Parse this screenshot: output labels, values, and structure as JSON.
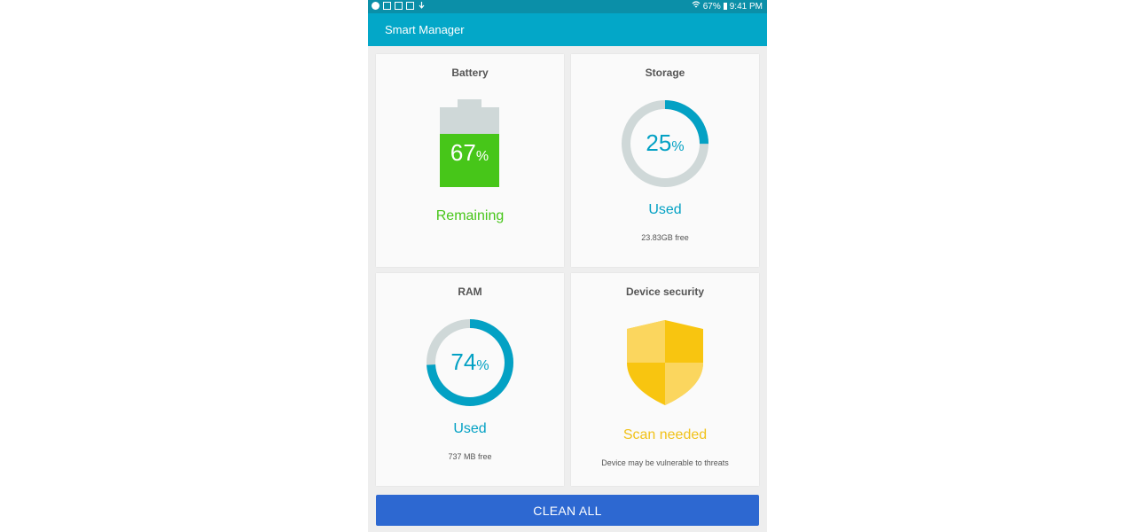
{
  "status_bar": {
    "battery": "67%",
    "time": "9:41 PM"
  },
  "app_bar": {
    "title": "Smart Manager"
  },
  "battery": {
    "title": "Battery",
    "value": "67",
    "unit": "%",
    "fraction": 0.67,
    "status": "Remaining",
    "color": "#47c619"
  },
  "storage": {
    "title": "Storage",
    "value": "25",
    "unit": "%",
    "fraction": 0.25,
    "status": "Used",
    "detail": "23.83GB free",
    "color": "#03a1c4"
  },
  "ram": {
    "title": "RAM",
    "value": "74",
    "unit": "%",
    "fraction": 0.74,
    "status": "Used",
    "detail": "737 MB free",
    "color": "#03a1c4"
  },
  "security": {
    "title": "Device security",
    "status": "Scan needed",
    "detail": "Device may be vulnerable to threats",
    "color": "#f1c21a"
  },
  "actions": {
    "clean_all": "CLEAN ALL"
  }
}
